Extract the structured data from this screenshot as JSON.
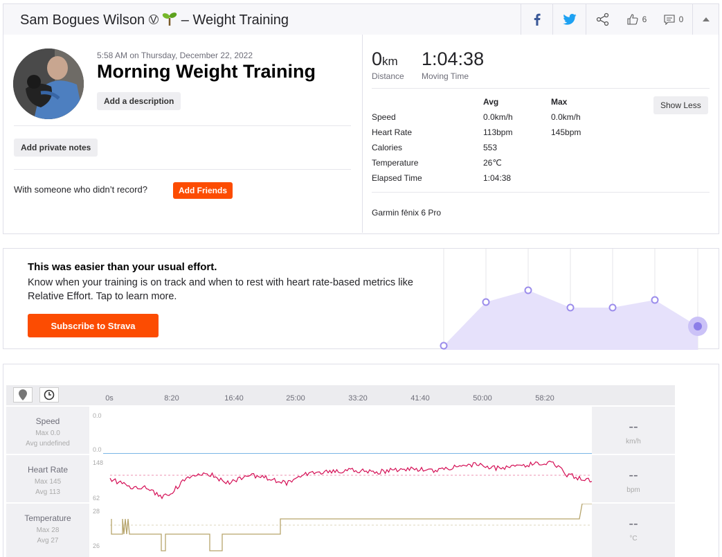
{
  "header": {
    "athlete": "Sam Bogues Wilson",
    "subscriber_mark": "V",
    "separator": "–",
    "sport": "Weight Training",
    "kudos_count": "6",
    "comment_count": "0"
  },
  "activity": {
    "datetime": "5:58 AM on Thursday, December 22, 2022",
    "title": "Morning Weight Training",
    "add_description": "Add a description",
    "add_private_notes": "Add private notes",
    "with_someone": "With someone who didn’t record?",
    "add_friends": "Add Friends"
  },
  "stats": {
    "distance_value": "0",
    "distance_unit": "km",
    "distance_label": "Distance",
    "moving_time_value": "1:04:38",
    "moving_time_label": "Moving Time",
    "avg_header": "Avg",
    "max_header": "Max",
    "show_less": "Show Less",
    "rows": [
      {
        "label": "Speed",
        "avg": "0.0km/h",
        "max": "0.0km/h"
      },
      {
        "label": "Heart Rate",
        "avg": "113bpm",
        "max": "145bpm"
      },
      {
        "label": "Calories",
        "avg": "553",
        "max": ""
      },
      {
        "label": "Temperature",
        "avg": "26℃",
        "max": ""
      },
      {
        "label": "Elapsed Time",
        "avg": "1:04:38",
        "max": ""
      }
    ],
    "device": "Garmin fēnix 6 Pro"
  },
  "promo": {
    "heading": "This was easier than your usual effort.",
    "body": "Know when your training is on track and when to rest with heart rate-based metrics like Relative Effort. Tap to learn more.",
    "cta": "Subscribe to Strava",
    "accent_color": "#fc4c02",
    "chart_color": "#8c7ee8"
  },
  "analysis": {
    "time_ticks": [
      "0s",
      "8:20",
      "16:40",
      "25:00",
      "33:20",
      "41:40",
      "50:00",
      "58:20"
    ],
    "streams": [
      {
        "name": "Speed",
        "max": "Max 0.0",
        "avg": "Avg undefined",
        "axis_top": "0.0",
        "axis_bottom": "0.0",
        "value": "--",
        "unit": "km/h",
        "color": "#2a8ad6"
      },
      {
        "name": "Heart Rate",
        "max": "Max 145",
        "avg": "Avg 113",
        "axis_top": "148",
        "axis_bottom": "62",
        "value": "--",
        "unit": "bpm",
        "color": "#d40d54"
      },
      {
        "name": "Temperature",
        "max": "Max 28",
        "avg": "Avg 27",
        "axis_top": "28",
        "axis_bottom": "26",
        "value": "--",
        "unit": "°C",
        "color": "#b6a46b"
      }
    ]
  }
}
